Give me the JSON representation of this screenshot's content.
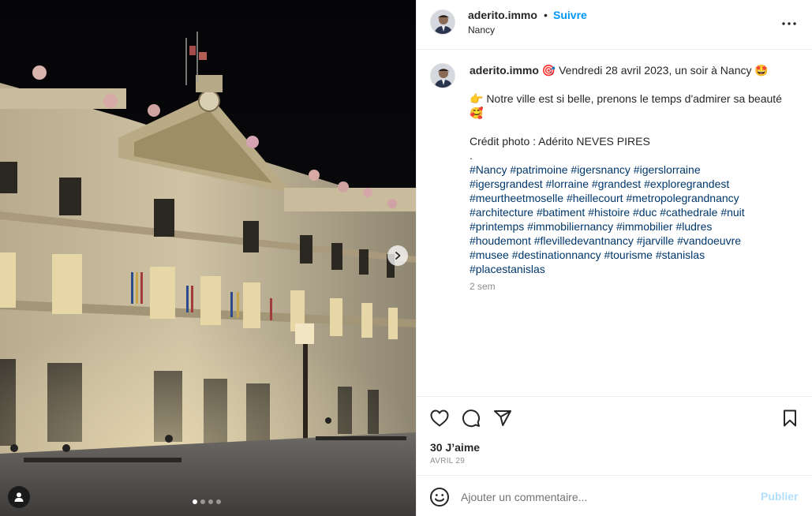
{
  "media": {
    "image_alt": "Hôtel de Ville, Place Stanislas, Nancy at night",
    "carousel": {
      "count": 4,
      "active_index": 0
    },
    "next_icon": "chevron-right-icon",
    "tag_icon": "user-icon"
  },
  "header": {
    "username": "aderito.immo",
    "separator": "•",
    "follow_label": "Suivre",
    "location": "Nancy",
    "more_icon": "more-horizontal-icon"
  },
  "caption": {
    "username": "aderito.immo",
    "line1": " 🎯 Vendredi 28 avril 2023, un soir à Nancy 🤩",
    "line2": "👉 Notre ville est si belle, prenons le temps d'admirer sa beauté 🥰",
    "line3": "Crédit photo : Adérito NEVES PIRES",
    "line4": ".",
    "hashtags": [
      "#Nancy",
      "#patrimoine",
      "#igersnancy",
      "#igerslorraine",
      "#igersgrandest",
      "#lorraine",
      "#grandest",
      "#exploregrandest",
      "#meurtheetmoselle",
      "#heillecourt",
      "#metropolegrandnancy",
      "#architecture",
      "#batiment",
      "#histoire",
      "#duc",
      "#cathedrale",
      "#nuit",
      "#printemps",
      "#immobiliernancy",
      "#immobilier",
      "#ludres",
      "#houdemont",
      "#flevilledevantnancy",
      "#jarville",
      "#vandoeuvre",
      "#musee",
      "#destinationnancy",
      "#tourisme",
      "#stanislas",
      "#placestanislas"
    ],
    "hashtag_lines": [
      [
        0,
        4
      ],
      [
        4,
        8
      ],
      [
        8,
        11
      ],
      [
        11,
        17
      ],
      [
        17,
        21
      ],
      [
        21,
        25
      ],
      [
        25,
        29
      ],
      [
        29,
        30
      ]
    ],
    "time_ago": "2 sem"
  },
  "actions": {
    "like_icon": "heart-icon",
    "comment_icon": "comment-icon",
    "share_icon": "paper-plane-icon",
    "save_icon": "bookmark-icon",
    "likes_label": "30 J’aime",
    "date_label": "AVRIL 29"
  },
  "comment": {
    "emoji_icon": "smiley-icon",
    "placeholder": "Ajouter un commentaire...",
    "value": "",
    "publish_label": "Publier"
  },
  "colors": {
    "link_blue": "#0095f6",
    "hashtag_blue": "#00376b",
    "publish_disabled": "#b2dffc",
    "muted": "#8e8e8e"
  }
}
